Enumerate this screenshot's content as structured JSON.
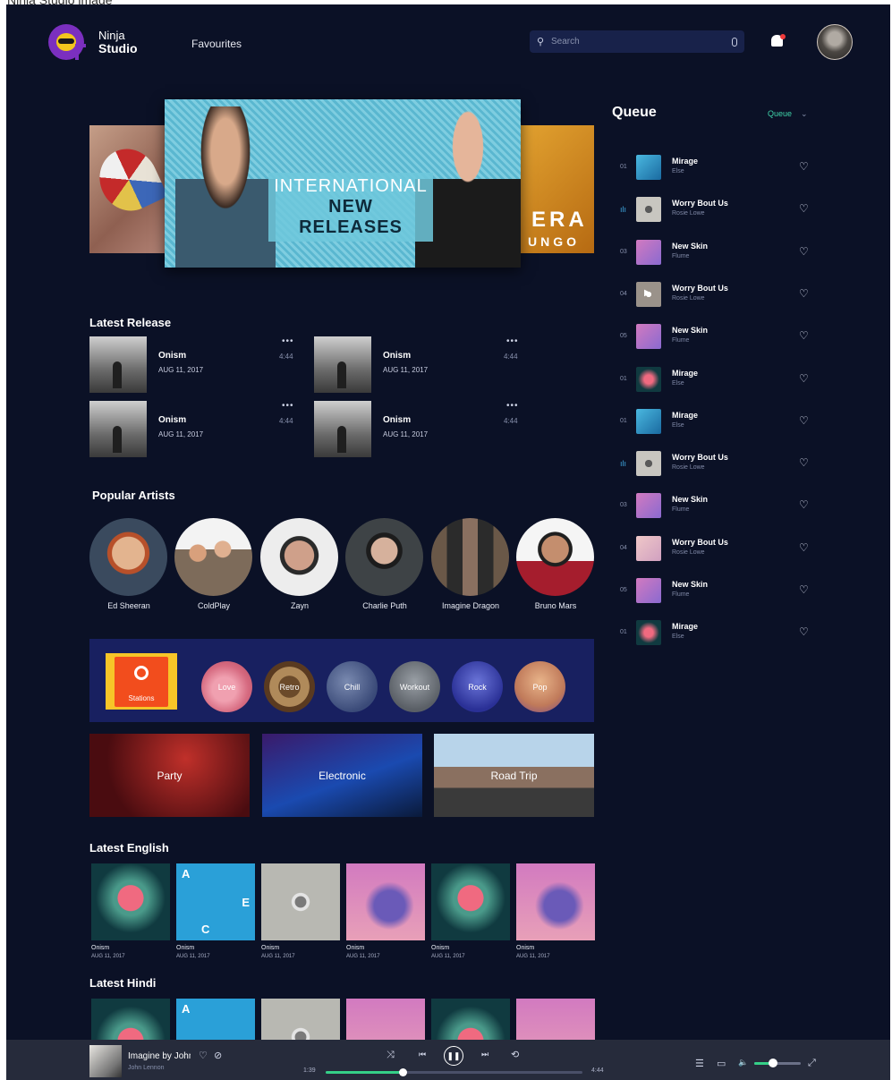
{
  "caption": "Ninja Studio image",
  "brand": {
    "line1": "Ninja",
    "line2": "Studio"
  },
  "nav": {
    "favourites": "Favourites"
  },
  "search": {
    "placeholder": "Search"
  },
  "banner": {
    "line1": "INTERNATIONAL",
    "line2": "NEW RELEASES",
    "side_right_line1": "ERA",
    "side_right_line2": "UNGO"
  },
  "latest_release": {
    "title": "Latest Release",
    "items": [
      {
        "title": "Onism",
        "date": "AUG 11, 2017",
        "duration": "4:44",
        "more": "•••"
      },
      {
        "title": "Onism",
        "date": "AUG 11, 2017",
        "duration": "4:44",
        "more": "•••"
      },
      {
        "title": "Onism",
        "date": "AUG 11, 2017",
        "duration": "4:44",
        "more": "•••"
      },
      {
        "title": "Onism",
        "date": "AUG 11, 2017",
        "duration": "4:44",
        "more": "•••"
      }
    ]
  },
  "popular_artists": {
    "title": "Popular Artists",
    "items": [
      {
        "name": "Ed Sheeran"
      },
      {
        "name": "ColdPlay"
      },
      {
        "name": "Zayn"
      },
      {
        "name": "Charlie Puth"
      },
      {
        "name": "Imagine Dragon"
      },
      {
        "name": "Bruno Mars"
      }
    ]
  },
  "stations": {
    "label": "Stations",
    "chips": [
      {
        "label": "Love"
      },
      {
        "label": "Retro"
      },
      {
        "label": "Chill"
      },
      {
        "label": "Workout"
      },
      {
        "label": "Rock"
      },
      {
        "label": "Pop"
      }
    ]
  },
  "moods": [
    {
      "label": "Party"
    },
    {
      "label": "Electronic"
    },
    {
      "label": "Road Trip"
    }
  ],
  "latest_english": {
    "title": "Latest English",
    "items": [
      {
        "title": "Onism",
        "date": "AUG 11, 2017"
      },
      {
        "title": "Onism",
        "date": "AUG 11, 2017"
      },
      {
        "title": "Onism",
        "date": "AUG 11, 2017"
      },
      {
        "title": "Onism",
        "date": "AUG 11, 2017"
      },
      {
        "title": "Onism",
        "date": "AUG 11, 2017"
      },
      {
        "title": "Onism",
        "date": "AUG 11, 2017"
      }
    ],
    "cover_letters": {
      "a": "A",
      "e": "E",
      "c": "C"
    }
  },
  "latest_hindi": {
    "title": "Latest Hindi",
    "cover_letter": "A"
  },
  "queue": {
    "title": "Queue",
    "dropdown": "Queue",
    "chevron": "⌄",
    "playing_glyph": "ılı",
    "play_glyph": "▶",
    "items": [
      {
        "num": "01",
        "title": "Mirage",
        "artist": "Else"
      },
      {
        "num": "",
        "title": "Worry Bout Us",
        "artist": "Rosie Lowe"
      },
      {
        "num": "03",
        "title": "New Skin",
        "artist": "Flume"
      },
      {
        "num": "04",
        "title": "Worry Bout Us",
        "artist": "Rosie Lowe"
      },
      {
        "num": "05",
        "title": "New Skin",
        "artist": "Flume"
      },
      {
        "num": "01",
        "title": "Mirage",
        "artist": "Else"
      },
      {
        "num": "01",
        "title": "Mirage",
        "artist": "Else"
      },
      {
        "num": "",
        "title": "Worry Bout Us",
        "artist": "Rosie Lowe"
      },
      {
        "num": "03",
        "title": "New Skin",
        "artist": "Flume"
      },
      {
        "num": "04",
        "title": "Worry Bout Us",
        "artist": "Rosie Lowe"
      },
      {
        "num": "05",
        "title": "New Skin",
        "artist": "Flume"
      },
      {
        "num": "01",
        "title": "Mirage",
        "artist": "Else"
      }
    ]
  },
  "player": {
    "title": "Imagine by John Lennon",
    "artist": "John Lennon",
    "elapsed": "1:39",
    "total": "4:44",
    "progress": 0.3,
    "volume": 0.4
  },
  "icons": {
    "search": "⚲",
    "heart": "♡",
    "block": "⊘",
    "shuffle": "⤨",
    "prev": "⏮",
    "pause": "❚❚",
    "next": "⏭",
    "repeat": "⟲",
    "queue_list": "☰",
    "devices": "▭",
    "speaker": "🔈",
    "fullscreen": "⤢"
  },
  "colors": {
    "background": "#0b1126",
    "accent": "#35d088",
    "queue_accent": "#3fd2a8",
    "stations_panel": "#182060"
  }
}
